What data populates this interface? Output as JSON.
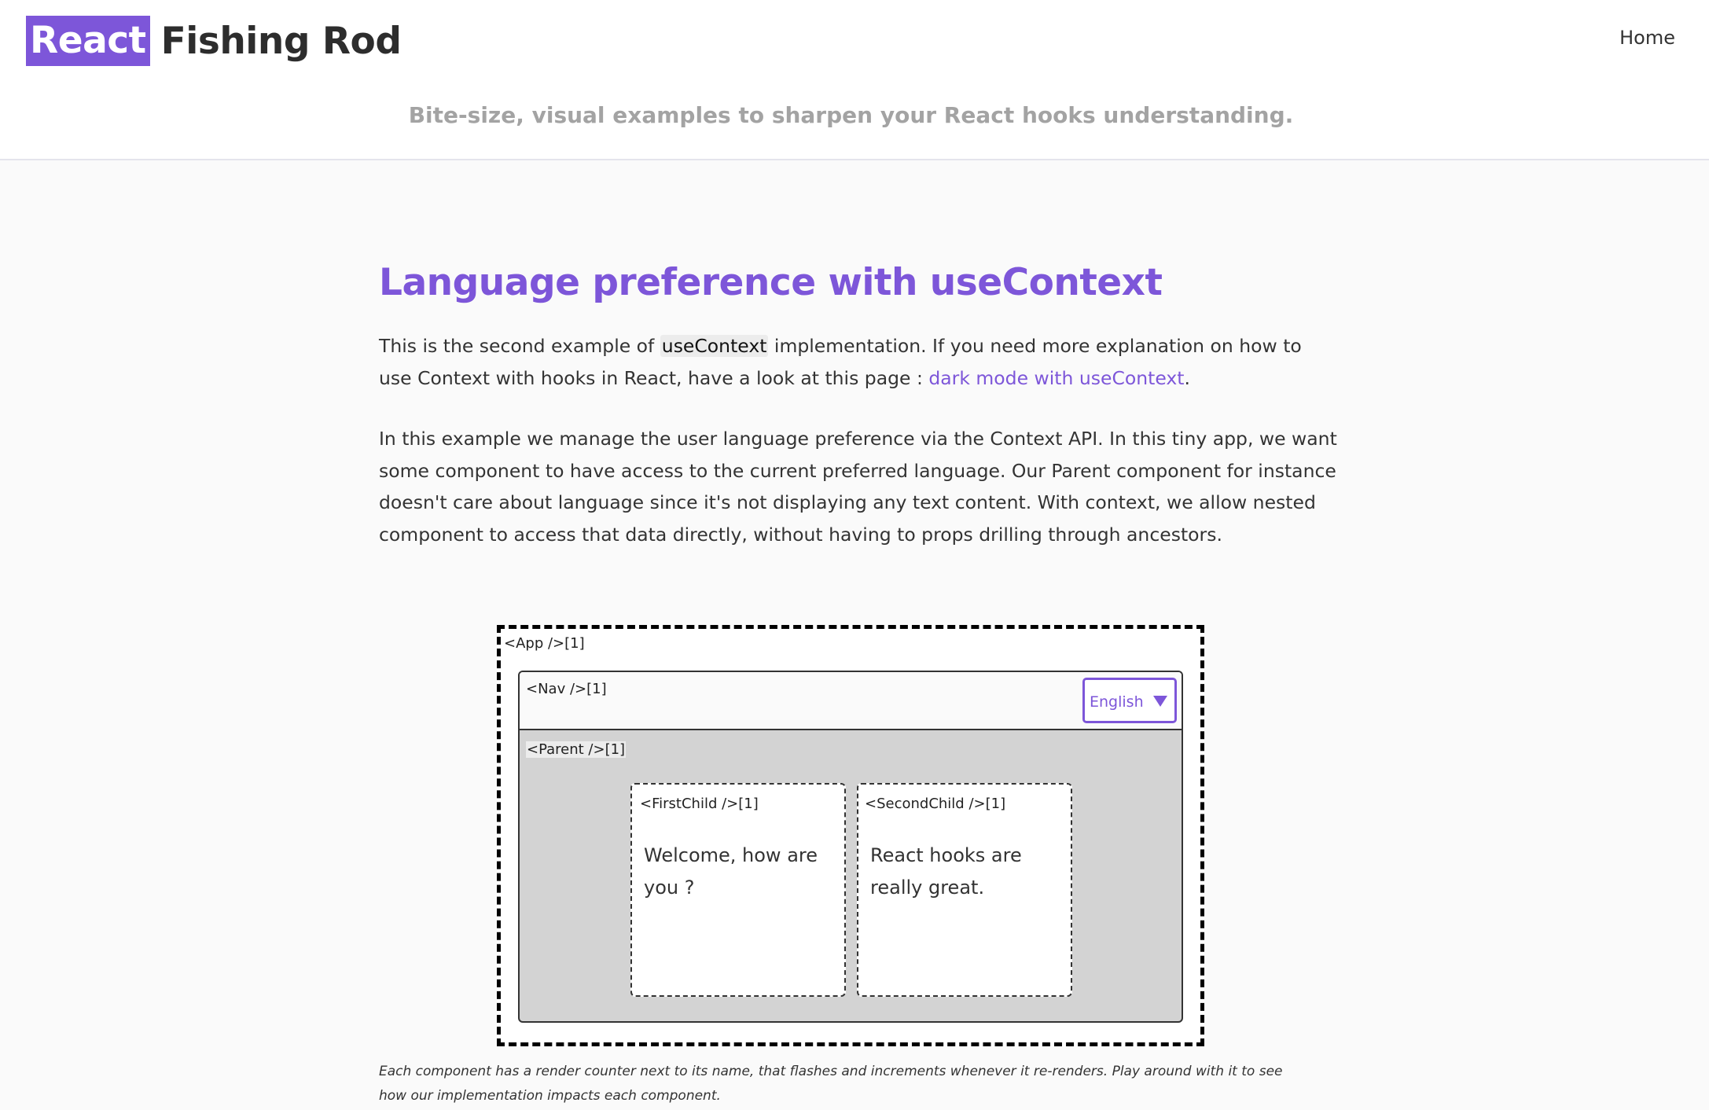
{
  "header": {
    "logo_badge": "React",
    "logo_text": "Fishing Rod",
    "nav_home": "Home",
    "tagline": "Bite-size, visual examples to sharpen your React hooks understanding."
  },
  "article": {
    "title": "Language preference with useContext",
    "para1": {
      "before_code": "This is the second example of ",
      "code": "useContext",
      "after_code": " implementation. If you need more explanation on how to use Context with hooks in React, have a look at this page : ",
      "link": "dark mode with useContext",
      "end": "."
    },
    "para2": "In this example we manage the user language preference via the Context API. In this tiny app, we want some component to have access to the current preferred language. Our Parent component for instance doesn't care about language since it's not displaying any text content. With context, we allow nested component to access that data directly, without having to props drilling through ancestors."
  },
  "demo": {
    "app_label": "<App />[1]",
    "nav_label": "<Nav />[1]",
    "language_select": {
      "value": "English"
    },
    "parent_label": "<Parent />[1]",
    "first_child": {
      "label": "<FirstChild />[1]",
      "text": "Welcome, how are you ?"
    },
    "second_child": {
      "label": "<SecondChild />[1]",
      "text": "React hooks are really great."
    }
  },
  "caption": "Each component has a render counter next to its name, that flashes and increments whenever it re-renders. Play around with it to see how our implementation impacts each component.",
  "colors": {
    "accent": "#7d56d9",
    "parent_bg": "#d3d3d3",
    "tagline": "#a3a3a3"
  }
}
